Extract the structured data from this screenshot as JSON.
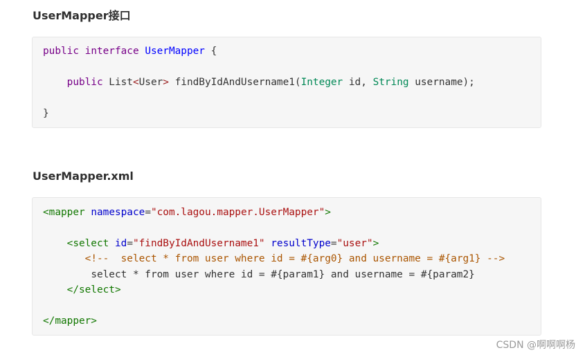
{
  "sections": [
    {
      "title": "UserMapper接口",
      "code": {
        "l1": {
          "kw": "public",
          "sp1": " ",
          "kw2": "interface",
          "sp2": " ",
          "def": "UserMapper",
          "rest": " {"
        },
        "l2": {
          "indent": "    ",
          "kw": "public",
          "plain1": " List",
          "op1": "<",
          "plain2": "User",
          "op2": ">",
          "plain3": " findByIdAndUsername1(",
          "typ1": "Integer",
          "plain4": " id, ",
          "typ2": "String",
          "plain5": " username);"
        },
        "l3": {
          "plain": "}"
        }
      }
    },
    {
      "title": "UserMapper.xml",
      "code": {
        "l1": {
          "tag_open": "<mapper",
          "sp": " ",
          "attr": "namespace",
          "eq": "=",
          "str": "\"com.lagou.mapper.UserMapper\"",
          "tag_close": ">"
        },
        "l2": {
          "indent": "    ",
          "tag_open": "<select",
          "sp1": " ",
          "attr1": "id",
          "eq1": "=",
          "str1": "\"findByIdAndUsername1\"",
          "sp2": " ",
          "attr2": "resultType",
          "eq2": "=",
          "str2": "\"user\"",
          "tag_close": ">"
        },
        "l3": {
          "indent": "       ",
          "comment": "<!--  select * from user where id = #{arg0} and username = #{arg1} -->"
        },
        "l4": {
          "indent": "        ",
          "plain": "select * from user where id = #{param1} and username = #{param2}"
        },
        "l5": {
          "indent": "    ",
          "tag": "</select>"
        },
        "l6": {
          "tag": "</mapper>"
        }
      }
    }
  ],
  "watermark": "CSDN @啊啊啊杨"
}
